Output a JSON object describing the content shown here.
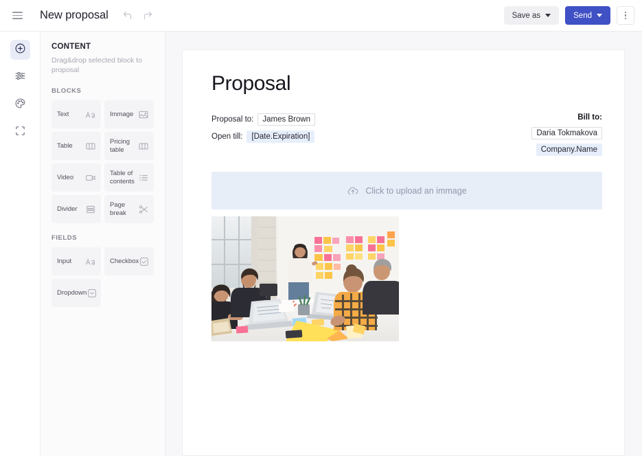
{
  "topbar": {
    "menu_icon": "hamburger-icon",
    "title": "New proposal",
    "undo_icon": "undo-icon",
    "redo_icon": "redo-icon",
    "save_as_label": "Save as",
    "send_label": "Send",
    "more_icon": "kebab-menu-icon",
    "primary_color": "#3f51c4",
    "secondary_color": "#f0f0f3"
  },
  "rail": {
    "items": [
      {
        "name": "add-block",
        "icon": "plus-circle-icon",
        "active": true
      },
      {
        "name": "settings",
        "icon": "sliders-icon",
        "active": false
      },
      {
        "name": "theme",
        "icon": "palette-icon",
        "active": false
      },
      {
        "name": "layout",
        "icon": "crop-frame-icon",
        "active": false
      }
    ],
    "active_bg": "#e9ecf7"
  },
  "panel": {
    "title": "CONTENT",
    "subtitle": "Drag&drop selected block to proposal",
    "blocks_label": "BLOCKS",
    "blocks": [
      {
        "label": "Text",
        "icon": "text-aa-icon"
      },
      {
        "label": "Immage",
        "icon": "image-icon"
      },
      {
        "label": "Table",
        "icon": "table-columns-icon"
      },
      {
        "label": "Pricing table",
        "icon": "table-columns-icon"
      },
      {
        "label": "Video",
        "icon": "video-camera-icon"
      },
      {
        "label": "Table of contents",
        "icon": "list-icon"
      },
      {
        "label": "Divider",
        "icon": "divider-icon"
      },
      {
        "label": "Page break",
        "icon": "scissors-icon"
      }
    ],
    "fields_label": "FIELDS",
    "fields": [
      {
        "label": "Input",
        "icon": "text-aa-icon"
      },
      {
        "label": "Checkbox",
        "icon": "checkbox-checked-icon"
      },
      {
        "label": "Dropdown",
        "icon": "chevron-down-box-icon"
      }
    ]
  },
  "document": {
    "heading": "Proposal",
    "proposal_to_label": "Proposal to:",
    "proposal_to_value": "James Brown",
    "open_till_label": "Open till:",
    "open_till_value": "[Date.Expiration]",
    "bill_to_label": "Bill to:",
    "bill_to_name": "Daria Tokmakova",
    "bill_to_company": "Company.Name",
    "upload_icon": "cloud-upload-icon",
    "upload_text": "Click to upload an immage",
    "upload_bg": "#e8eef8",
    "photo_alt": "team-meeting-photo",
    "token_color": "#e7eefb"
  }
}
